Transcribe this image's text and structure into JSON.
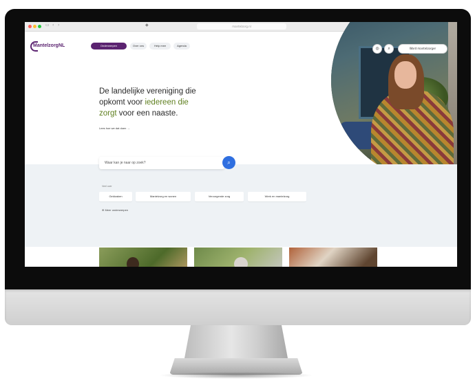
{
  "browser": {
    "url": "mantelzorg.nl"
  },
  "site": {
    "logo": "MantelzorgNL",
    "nav": {
      "primary": "Onderwerpen",
      "item1": "Over ons",
      "item2": "Help mee",
      "item3": "Agenda"
    },
    "header_buttons": {
      "pill": "Word mantelzorger"
    }
  },
  "hero": {
    "headline_line1": "De landelijke vereniging die",
    "headline_line2_a": "opkomt voor ",
    "headline_line2_b": "iedereen die",
    "headline_line3_a": "zorgt",
    "headline_line3_b": " voor een naaste.",
    "more_link": "Lees hoe we dat doen  →"
  },
  "search": {
    "placeholder": "Waar kan je naar op zoek?"
  },
  "topics": {
    "label": "Veel over",
    "chips": [
      "Geldzaken",
      "Mantelzorg en wonen",
      "Verzorgende zorg",
      "Werk en mantelzorg"
    ],
    "more": "Meer onderwerpen"
  },
  "colors": {
    "brand_purple": "#5b2370",
    "accent_green": "#5f7f1f",
    "search_blue": "#2f6fe0"
  }
}
